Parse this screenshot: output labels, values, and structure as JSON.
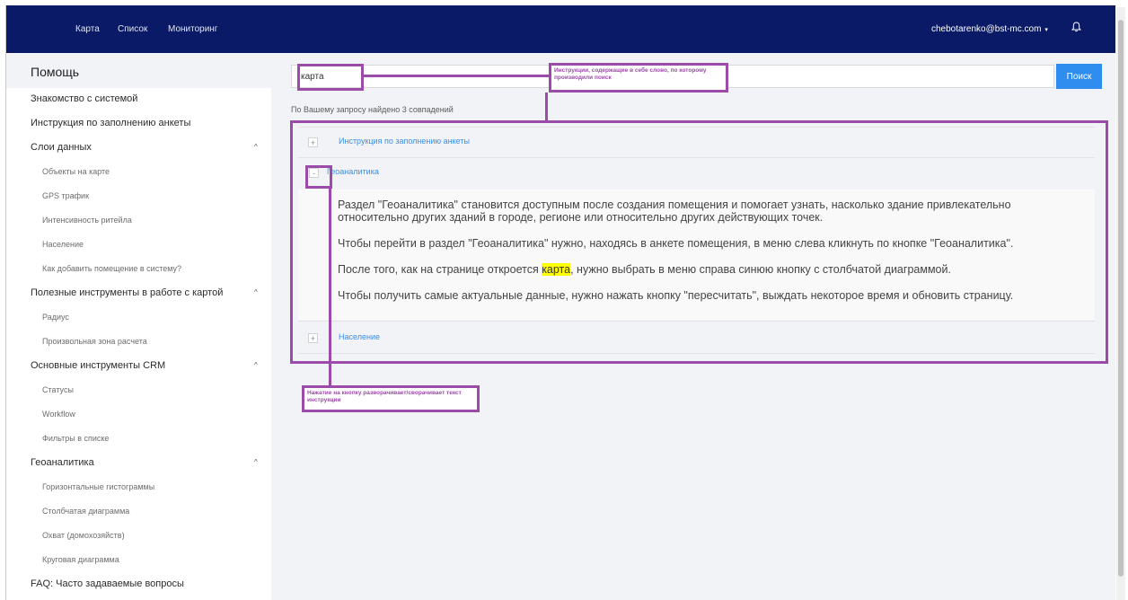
{
  "topbar": {
    "nav": [
      "Карта",
      "Список",
      "Мониторинг"
    ],
    "user_email": "chebotarenko@bst-mc.com",
    "caret": "▾"
  },
  "sidebar": {
    "title": "Помощь",
    "items": [
      {
        "type": "section",
        "label": "Знакомство с системой"
      },
      {
        "type": "section",
        "label": "Инструкция по заполнению анкеты"
      },
      {
        "type": "section",
        "label": "Слои данных",
        "chevron": "^"
      },
      {
        "type": "sub",
        "label": "Объекты на карте"
      },
      {
        "type": "sub",
        "label": "GPS трафик"
      },
      {
        "type": "sub",
        "label": "Интенсивность ритейла"
      },
      {
        "type": "sub",
        "label": "Население"
      },
      {
        "type": "sub",
        "label": "Как добавить помещение в систему?"
      },
      {
        "type": "section",
        "label": "Полезные инструменты в работе с картой",
        "chevron": "^"
      },
      {
        "type": "sub",
        "label": "Радиус"
      },
      {
        "type": "sub",
        "label": "Произвольная зона расчета"
      },
      {
        "type": "section",
        "label": "Основные инструменты CRM",
        "chevron": "^"
      },
      {
        "type": "sub",
        "label": "Статусы"
      },
      {
        "type": "sub",
        "label": "Workflow"
      },
      {
        "type": "sub",
        "label": "Фильтры в списке"
      },
      {
        "type": "section",
        "label": "Геоаналитика",
        "chevron": "^"
      },
      {
        "type": "sub",
        "label": "Горизонтальные гистограммы"
      },
      {
        "type": "sub",
        "label": "Столбчатая диаграмма"
      },
      {
        "type": "sub",
        "label": "Охват (домохозяйств)"
      },
      {
        "type": "sub",
        "label": "Круговая диаграмма"
      },
      {
        "type": "section",
        "label": "FAQ: Часто задаваемые вопросы"
      }
    ]
  },
  "search": {
    "value": "карта",
    "button_label": "Поиск",
    "result_text": "По Вашему запросу найдено 3 совпадений"
  },
  "results": {
    "item1": {
      "title": "Инструкция по заполнению анкеты",
      "toggle": "+"
    },
    "item2": {
      "title": "Геоаналитика",
      "toggle": "-",
      "p1": "Раздел \"Геоаналитика\" становится доступным после создания помещения и помогает узнать, насколько здание привлекательно относительно других зданий в городе, регионе или относительно других действующих точек.",
      "p2": "Чтобы перейти в раздел \"Геоаналитика\" нужно, находясь в анкете помещения, в меню слева кликнуть по кнопке \"Геоаналитика\".",
      "p3_before": "После того, как на странице откроется ",
      "p3_highlight": "карта",
      "p3_after": ", нужно выбрать в меню справа синюю кнопку с столбчатой диаграммой.",
      "p4": "Чтобы получить самые актуальные данные, нужно нажать кнопку \"пересчитать\", выждать некоторое время и обновить страницу."
    },
    "item3": {
      "title": "Население",
      "toggle": "+"
    }
  },
  "annotations": {
    "search_note": "Инструкции, содержащие в себе слово, по которому производили поиск",
    "toggle_note": "Нажатие на кнопку разворачивает/сворачивает текст инструкции"
  },
  "colors": {
    "topbar": "#0a1a66",
    "accent": "#2f8def",
    "annotation": "#9b4ba8",
    "highlight": "#ffff00"
  }
}
